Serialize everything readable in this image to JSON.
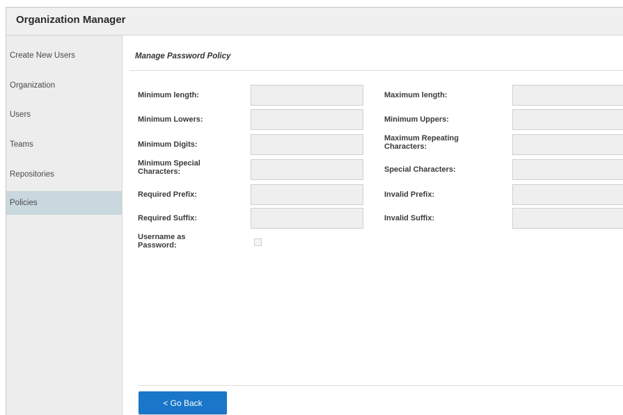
{
  "app": {
    "title": "Organization Manager"
  },
  "sidebar": {
    "items": [
      {
        "label": "Create New Users",
        "active": false
      },
      {
        "label": "Organization",
        "active": false
      },
      {
        "label": "Users",
        "active": false
      },
      {
        "label": "Teams",
        "active": false
      },
      {
        "label": "Repositories",
        "active": false
      },
      {
        "label": "Policies",
        "active": true
      }
    ]
  },
  "policy": {
    "title": "Manage Password Policy",
    "min_length": {
      "label": "Minimum length:",
      "value": ""
    },
    "max_length": {
      "label": "Maximum length:",
      "value": ""
    },
    "min_lowers": {
      "label": "Minimum Lowers:",
      "value": ""
    },
    "min_uppers": {
      "label": "Minimum Uppers:",
      "value": ""
    },
    "min_digits": {
      "label": "Minimum Digits:",
      "value": ""
    },
    "max_repeating": {
      "label": "Maximum Repeating Characters:",
      "value": ""
    },
    "min_special": {
      "label": "Minimum Special Characters:",
      "value": ""
    },
    "special_chars": {
      "label": "Special Characters:",
      "value": ""
    },
    "required_prefix": {
      "label": "Required Prefix:",
      "value": ""
    },
    "invalid_prefix": {
      "label": "Invalid Prefix:",
      "value": ""
    },
    "required_suffix": {
      "label": "Required Suffix:",
      "value": ""
    },
    "invalid_suffix": {
      "label": "Invalid Suffix:",
      "value": ""
    },
    "username_as_password": {
      "label": "Username as Password:",
      "checked": false
    }
  },
  "actions": {
    "go_back_label": "< Go Back"
  },
  "colors": {
    "accent": "#1976c9",
    "active_nav": "#c9d7df",
    "sidebar_bg": "#ededed"
  }
}
